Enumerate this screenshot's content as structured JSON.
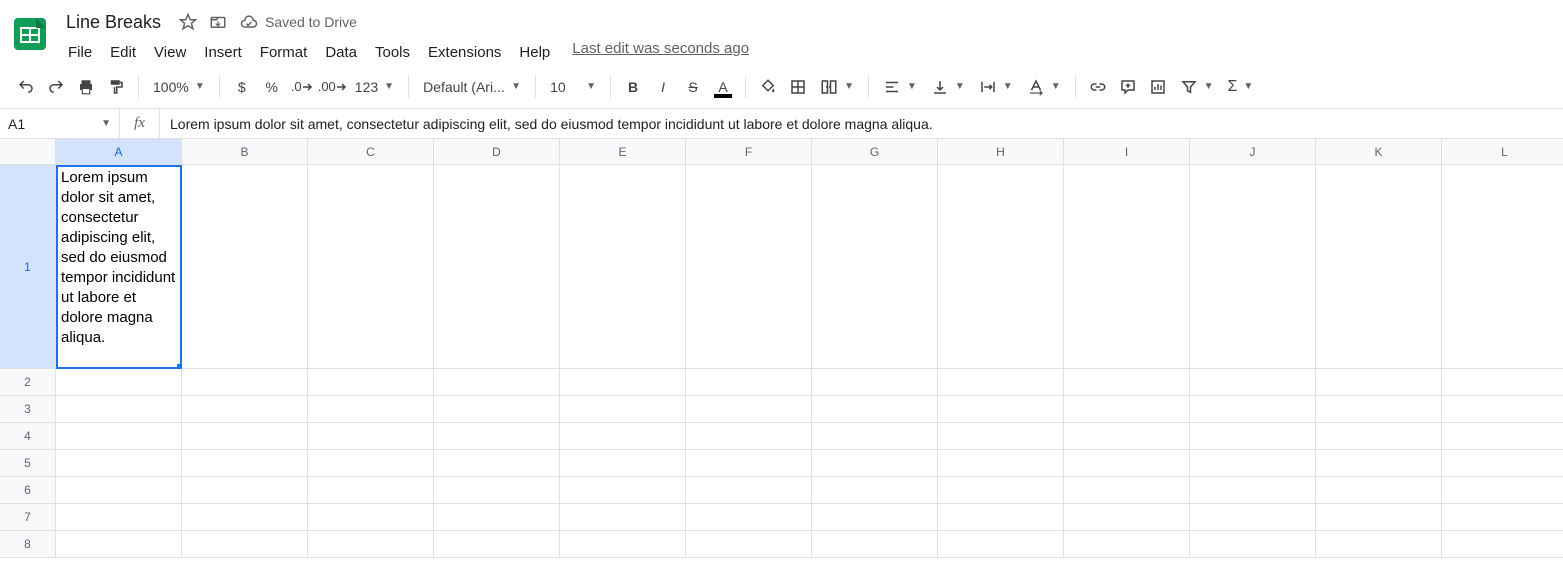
{
  "header": {
    "doc_title": "Line Breaks",
    "saved_status": "Saved to Drive",
    "menus": [
      "File",
      "Edit",
      "View",
      "Insert",
      "Format",
      "Data",
      "Tools",
      "Extensions",
      "Help"
    ],
    "last_edit": "Last edit was seconds ago"
  },
  "toolbar": {
    "zoom": "100%",
    "currency": "$",
    "percent": "%",
    "dec_dec": ".0",
    "inc_dec": ".00",
    "more_formats": "123",
    "font": "Default (Ari...",
    "font_size": "10",
    "bold": "B",
    "italic": "I",
    "strike": "S",
    "text_color": "A",
    "sigma": "Σ"
  },
  "namebox": {
    "cell_ref": "A1",
    "fx": "fx",
    "formula": "Lorem ipsum dolor sit amet, consectetur adipiscing elit, sed do eiusmod tempor incididunt ut labore et dolore magna aliqua."
  },
  "grid": {
    "columns": [
      "A",
      "B",
      "C",
      "D",
      "E",
      "F",
      "G",
      "H",
      "I",
      "J",
      "K",
      "L"
    ],
    "rows": [
      "1",
      "2",
      "3",
      "4",
      "5",
      "6",
      "7",
      "8"
    ],
    "selected_cell": "A1",
    "cells": {
      "A1": "Lorem ipsum dolor sit amet, consectetur adipiscing elit, sed do eiusmod tempor incididunt ut labore et dolore magna aliqua."
    }
  }
}
